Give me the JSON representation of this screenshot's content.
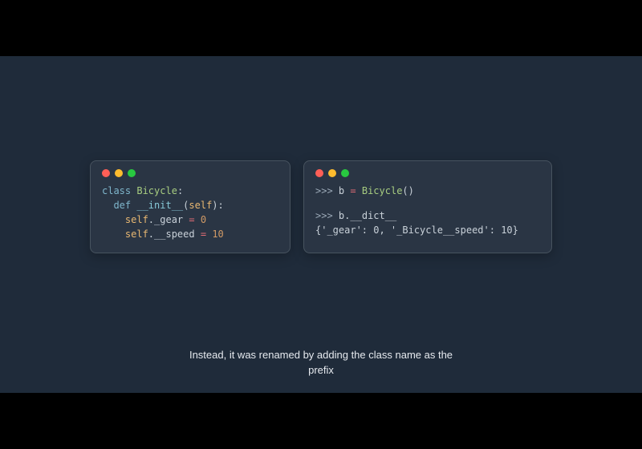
{
  "left_code": {
    "l1": {
      "kw": "class",
      "sp": " ",
      "cls": "Bicycle",
      "colon": ":"
    },
    "l2": {
      "kw": "def",
      "sp": " ",
      "fn": "__init__",
      "open": "(",
      "self": "self",
      "close": "):"
    },
    "l3": {
      "self": "self",
      "dot": ".",
      "attr": "_gear",
      "sp": " ",
      "op": "=",
      "sp2": " ",
      "num": "0"
    },
    "l4": {
      "self": "self",
      "dot": ".",
      "attr": "__speed",
      "sp": " ",
      "op": "=",
      "sp2": " ",
      "num": "10"
    }
  },
  "right_code": {
    "r1": {
      "pmt": ">>>",
      "sp": " ",
      "var": "b ",
      "op": "=",
      "sp2": " ",
      "cls": "Bicycle",
      "call": "()"
    },
    "r2": {
      "pmt": ">>>",
      "sp": " ",
      "var": "b",
      "dot": ".",
      "attr": "__dict__"
    },
    "r3": {
      "text": "{'_gear': 0, '_Bicycle__speed': 10}"
    }
  },
  "caption": {
    "line1": "Instead, it was renamed by adding the class name as the",
    "line2": "prefix"
  }
}
